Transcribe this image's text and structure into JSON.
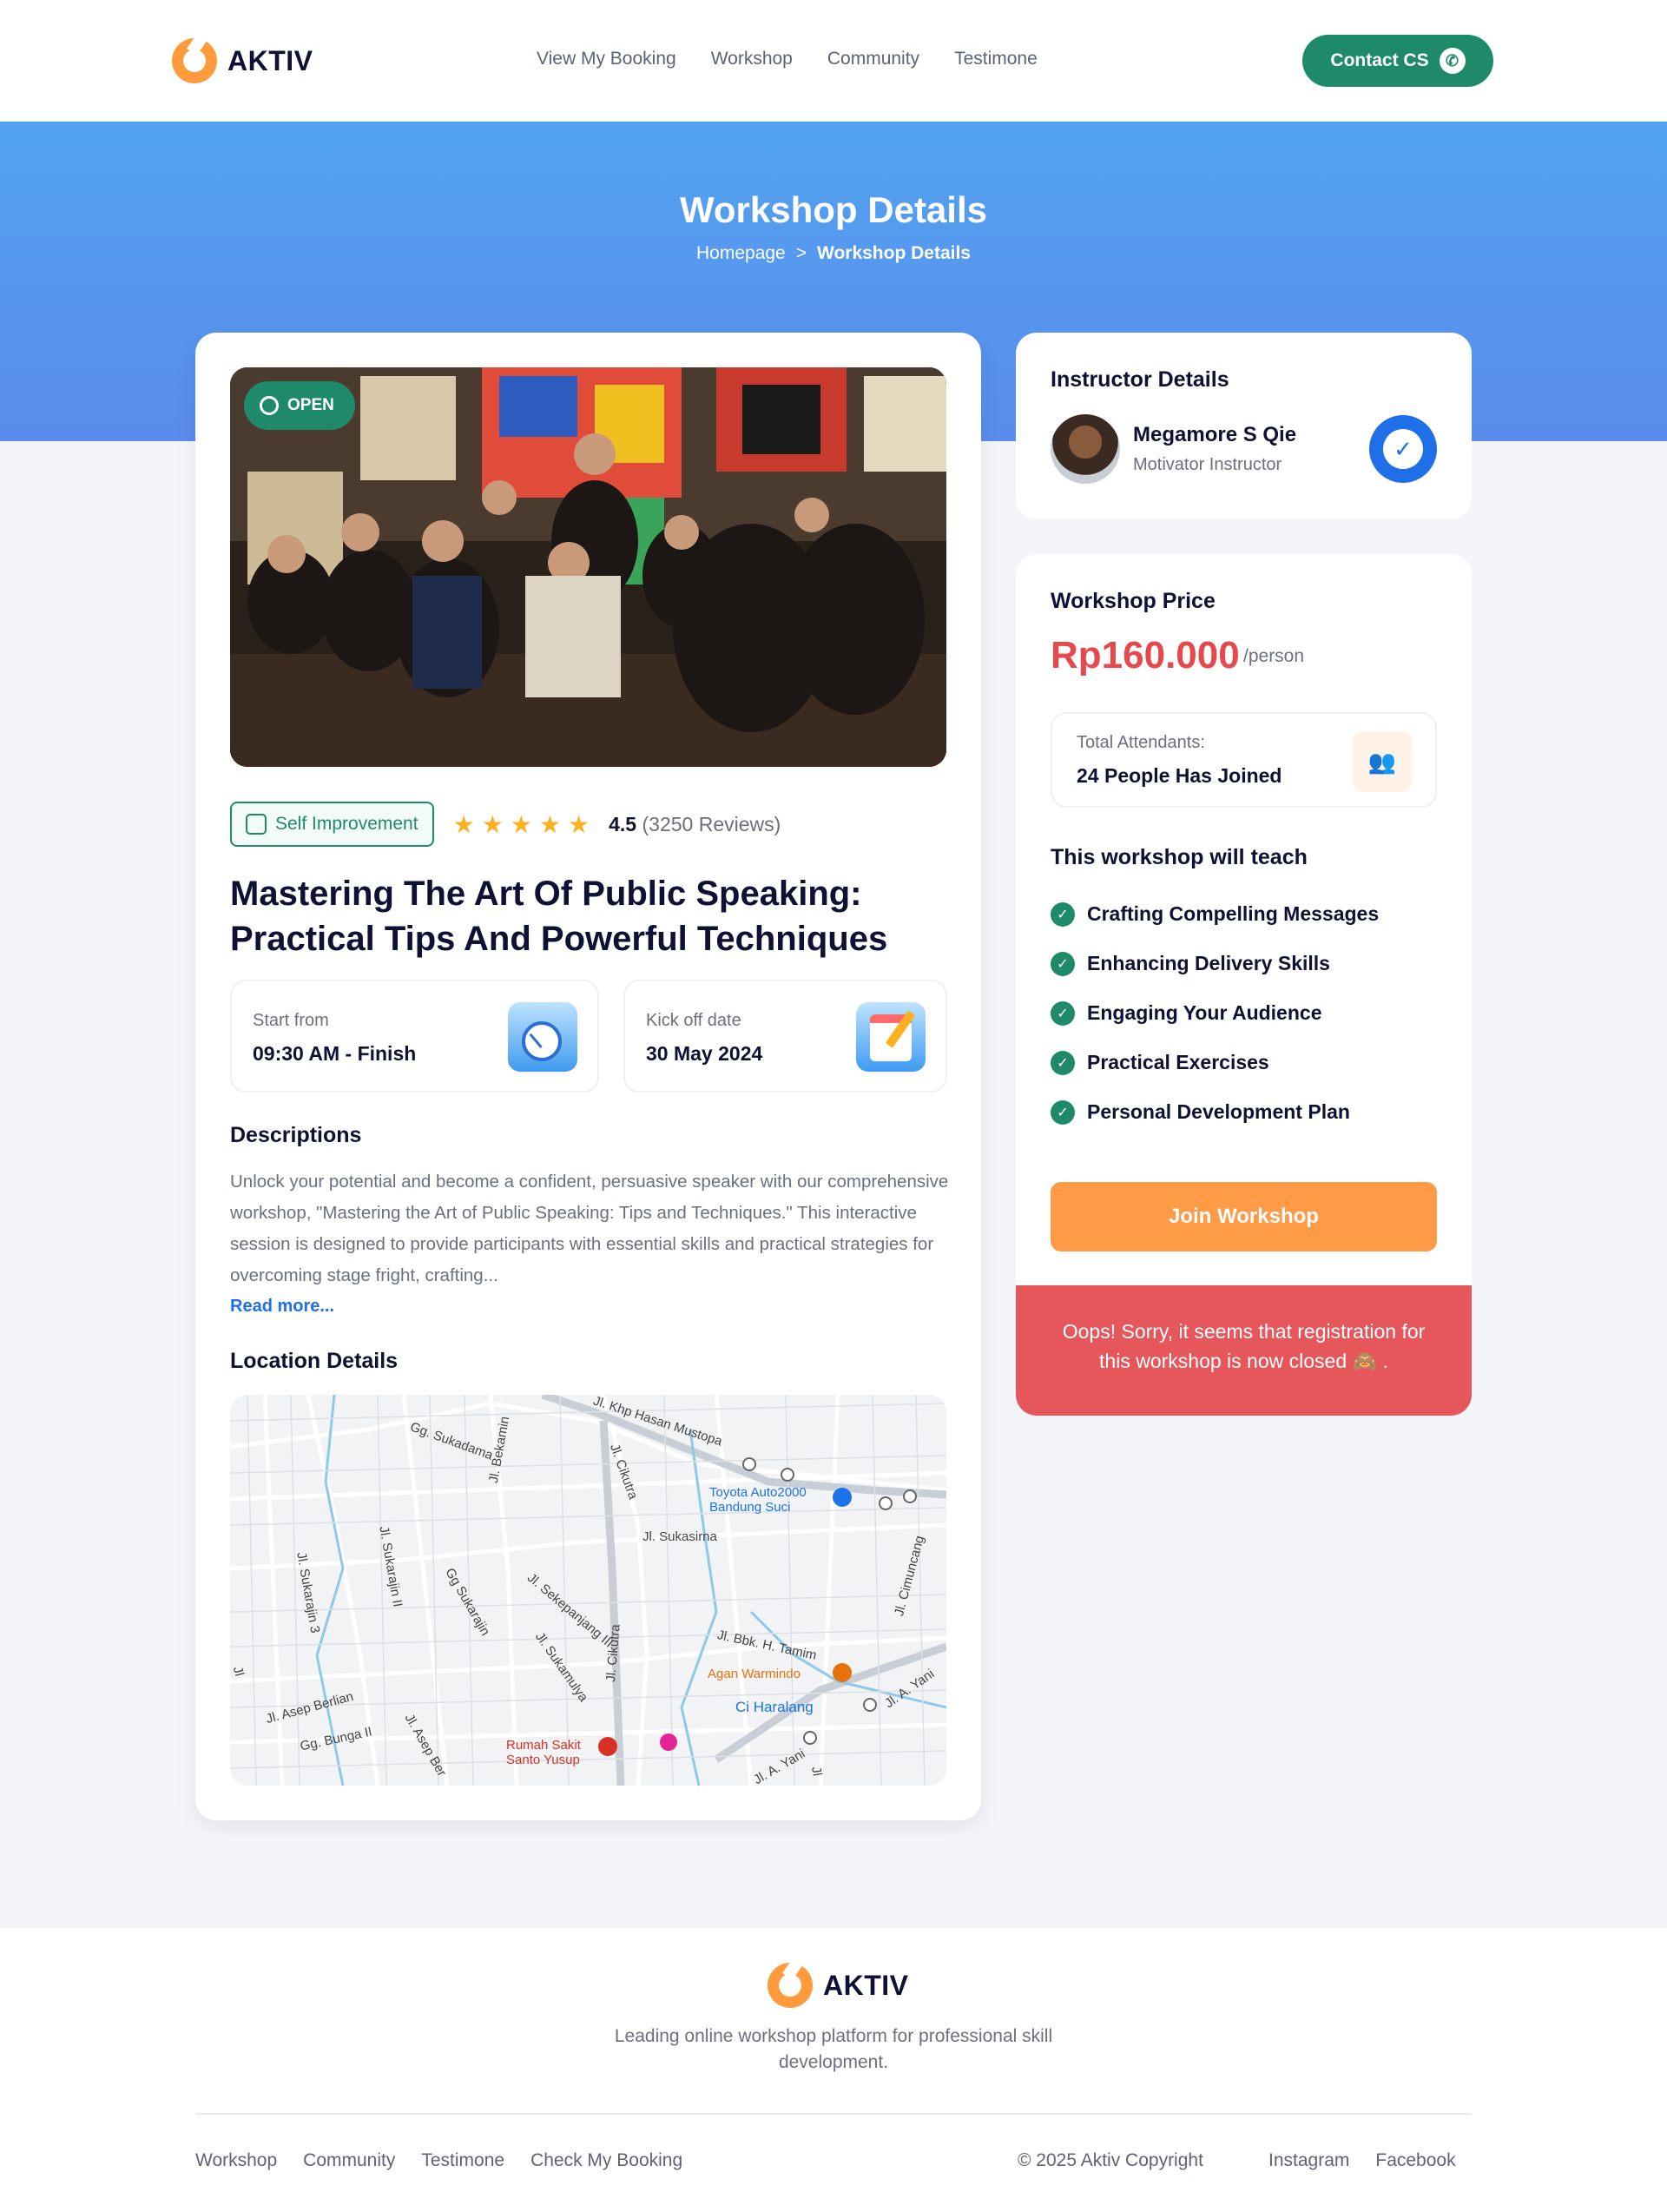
{
  "brand": {
    "name": "AKTIV",
    "color": "#FF9A3D"
  },
  "nav": {
    "links": [
      "View My Booking",
      "Workshop",
      "Community",
      "Testimone"
    ],
    "contact_label": "Contact CS"
  },
  "hero": {
    "title": "Workshop Details",
    "breadcrumb": {
      "home": "Homepage",
      "sep": ">",
      "current": "Workshop Details"
    }
  },
  "workshop": {
    "status": "OPEN",
    "category": "Self Improvement",
    "rating": "4.5",
    "stars": 5,
    "reviews": "(3250 Reviews)",
    "title": "Mastering The Art Of Public Speaking: Practical Tips And Powerful Techniques",
    "start_label": "Start from",
    "start_value": "09:30 AM - Finish",
    "date_label": "Kick off date",
    "date_value": "30 May 2024",
    "desc_heading": "Descriptions",
    "description": "Unlock your potential and become a confident, persuasive speaker with our comprehensive workshop, \"Mastering the Art of Public Speaking: Tips and Techniques.\" This interactive session is designed to provide participants with essential skills and practical strategies for overcoming stage fright, crafting...",
    "read_more": "Read more...",
    "location_heading": "Location Details"
  },
  "map": {
    "labels": [
      "Gg. Sukadama",
      "Jl. Bekamin",
      "Jl. Khp Hasan Mustopa",
      "Jl. Cikutra",
      "Jl. Sukarajin 3",
      "Jl. Sukarajin II",
      "Gg Sukarajin",
      "Jl. Sekepanjang III",
      "Jl. Sukasirna",
      "Jl. Cimuncang",
      "Jl. Sukamulya",
      "Jl. Cikutra",
      "Jl. Bbk. H. Tamim",
      "Jl. A. Yani",
      "Jl. Asep Berlian",
      "Gg. Bunga II",
      "Jl. Asep Ber",
      "Jl. A. Yani",
      "Jl",
      "Jl"
    ],
    "poi_toyota": "Toyota Auto2000\nBandung Suci",
    "poi_agan": "Agan Warmindo",
    "poi_ci": "Ci Haralang",
    "poi_rs": "Rumah Sakit\nSanto Yusup"
  },
  "instructor": {
    "heading": "Instructor Details",
    "name": "Megamore S Qie",
    "role": "Motivator Instructor"
  },
  "pricing": {
    "heading": "Workshop Price",
    "price": "Rp160.000",
    "per": "/person",
    "attendants_label": "Total Attendants:",
    "attendants_value": "24 People Has Joined",
    "teach_heading": "This workshop will teach",
    "teach_items": [
      "Crafting Compelling Messages",
      "Enhancing Delivery Skills",
      "Engaging Your Audience",
      "Practical Exercises",
      "Personal Development Plan"
    ],
    "join_label": "Join Workshop",
    "closed_message": "Oops! Sorry, it seems that registration for this workshop is now closed 🙈 ."
  },
  "footer": {
    "tagline": "Leading online workshop platform for professional skill development.",
    "links": [
      "Workshop",
      "Community",
      "Testimone",
      "Check My Booking"
    ],
    "copyright": "© 2025 Aktiv Copyright",
    "social": [
      "Instagram",
      "Facebook"
    ]
  },
  "colors": {
    "primary_green": "#1F8A6A",
    "hero_blue": "#52A3F0",
    "price_red": "#E5484D",
    "join_orange": "#FF9A46",
    "closed_red": "#E5575A"
  }
}
